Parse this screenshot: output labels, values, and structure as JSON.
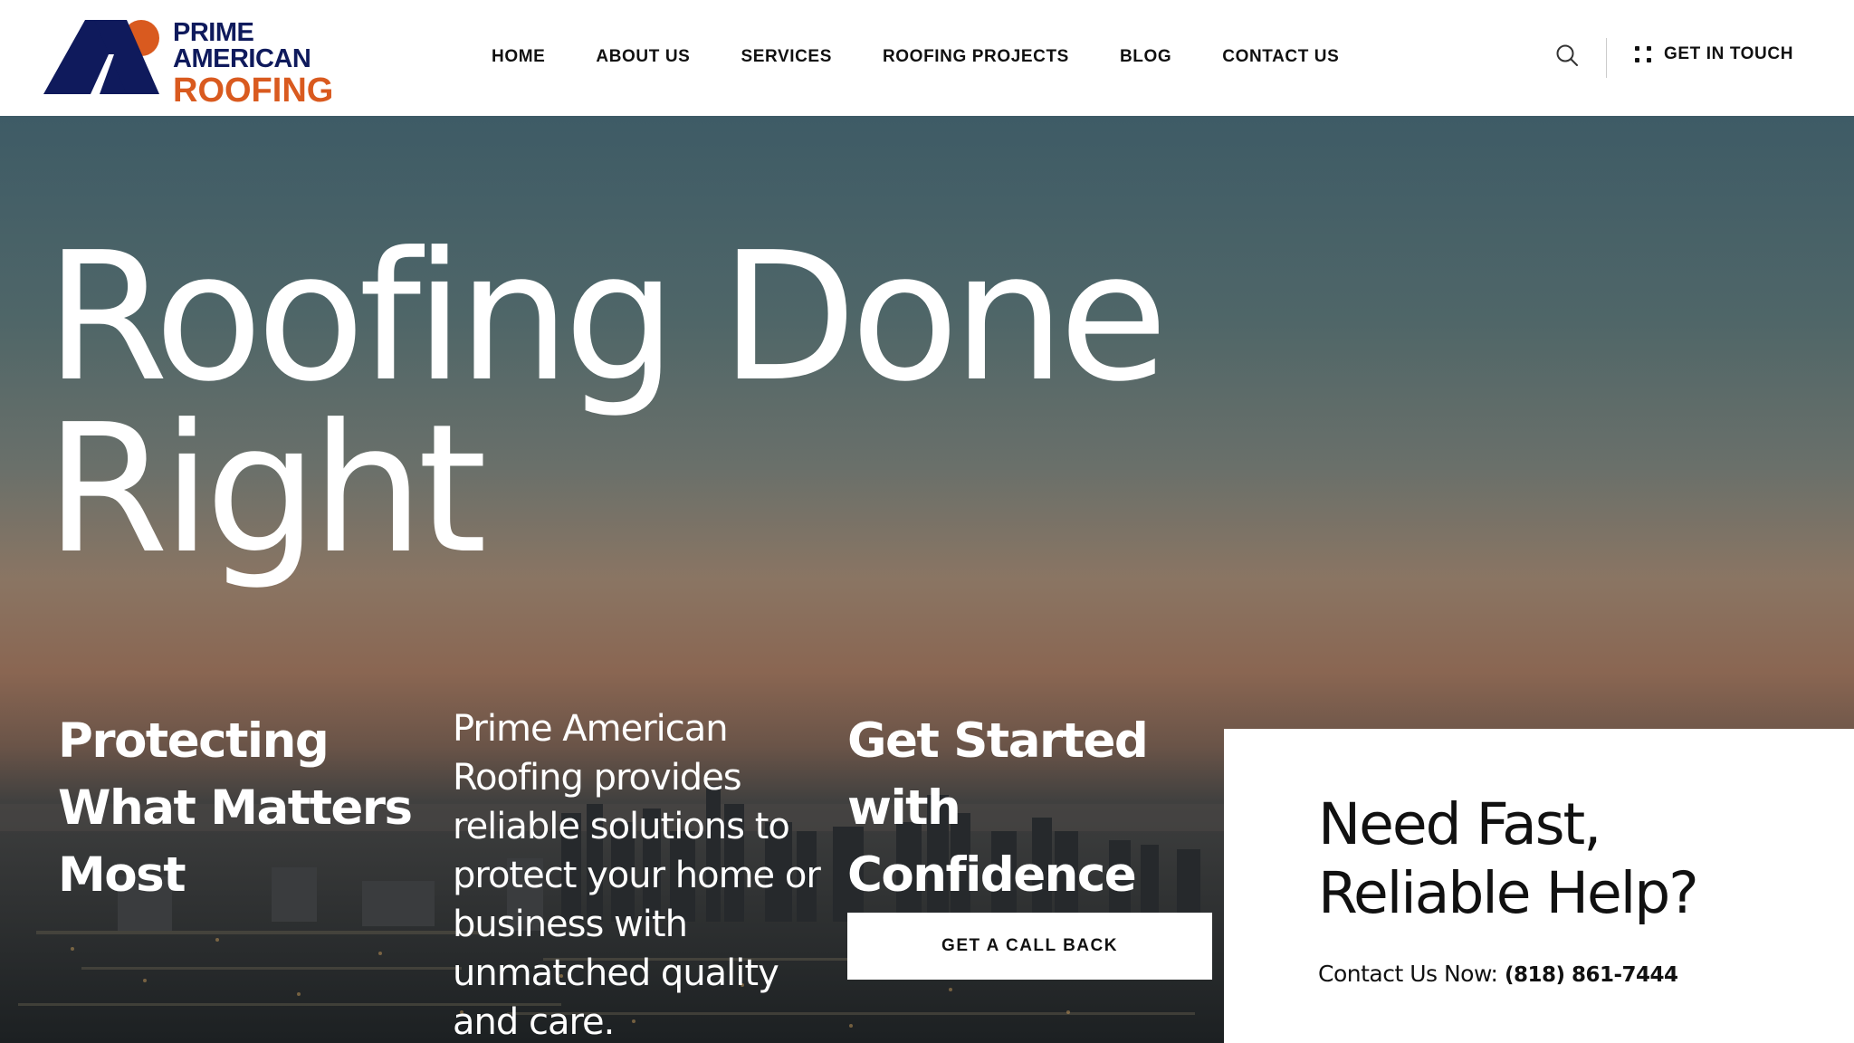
{
  "logo": {
    "line1": "PRIME",
    "line2": "AMERICAN",
    "line3": "ROOFING"
  },
  "nav": {
    "items": [
      {
        "label": "HOME"
      },
      {
        "label": "ABOUT US"
      },
      {
        "label": "SERVICES"
      },
      {
        "label": "ROOFING PROJECTS"
      },
      {
        "label": "BLOG"
      },
      {
        "label": "CONTACT US"
      }
    ]
  },
  "header": {
    "cta_label": "GET IN TOUCH"
  },
  "hero": {
    "title_line1": "Roofing Done",
    "title_line2": "Right",
    "col1_title": "Protecting What Matters Most",
    "col2_text": "Prime American Roofing provides reliable solutions to protect your home or business with unmatched quality and care.",
    "col3_title": "Get Started with Confidence",
    "callback_label": "GET A CALL BACK"
  },
  "help_card": {
    "title": "Need Fast, Reliable Help?",
    "contact_label": "Contact Us Now:",
    "phone": "(818) 861-7444"
  },
  "colors": {
    "brand_navy": "#0f1a5c",
    "brand_orange": "#d95a1f"
  },
  "icons": [
    "search-icon",
    "grid-dots-icon",
    "logo-mark-icon"
  ]
}
